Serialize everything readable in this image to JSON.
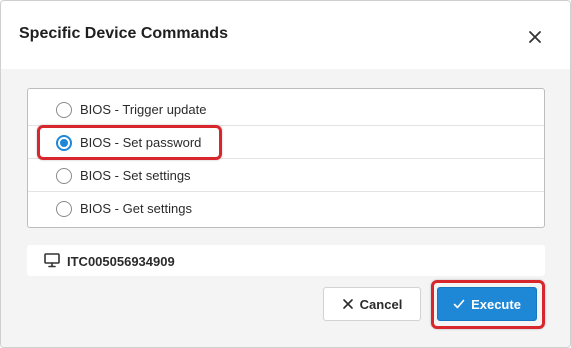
{
  "dialog": {
    "title": "Specific Device Commands",
    "close_icon": "close-icon"
  },
  "options": [
    {
      "label": "BIOS - Trigger update",
      "checked": false
    },
    {
      "label": "BIOS - Set password",
      "checked": true
    },
    {
      "label": "BIOS - Set settings",
      "checked": false
    },
    {
      "label": "BIOS - Get settings",
      "checked": false
    }
  ],
  "device": {
    "icon": "monitor-icon",
    "name": "ITC005056934909"
  },
  "buttons": {
    "cancel_label": "Cancel",
    "cancel_icon": "x-icon",
    "execute_label": "Execute",
    "execute_icon": "check-icon"
  },
  "colors": {
    "accent": "#1e88d6",
    "highlight": "#d7262c",
    "body_bg": "#f4f4f4"
  }
}
